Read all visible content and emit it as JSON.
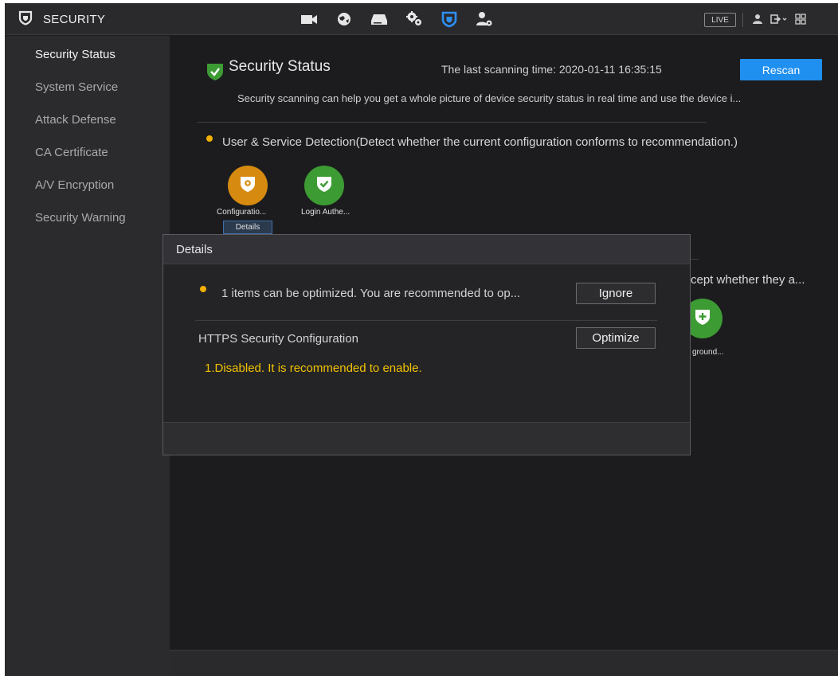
{
  "header": {
    "title": "SECURITY",
    "icons": [
      "camera-icon",
      "network-icon",
      "storage-icon",
      "system-settings-icon",
      "security-icon",
      "account-icon"
    ],
    "live_label": "LIVE",
    "right_icons": [
      "user-icon",
      "logout-icon",
      "menu-grid-icon"
    ]
  },
  "sidebar": {
    "items": [
      {
        "label": "Security Status",
        "active": true
      },
      {
        "label": "System Service",
        "active": false
      },
      {
        "label": "Attack Defense",
        "active": false
      },
      {
        "label": "CA Certificate",
        "active": false
      },
      {
        "label": "A/V Encryption",
        "active": false
      },
      {
        "label": "Security Warning",
        "active": false
      }
    ]
  },
  "main": {
    "title": "Security Status",
    "scan_time": "The last scanning time: 2020-01-11 16:35:15",
    "rescan_label": "Rescan",
    "description": "Security scanning can help you get a whole picture of device security status in real time and use the device i...",
    "user_service_section": "User & Service Detection(Detect whether the current configuration conforms to recommendation.)",
    "items": [
      {
        "label": "Configuratio...",
        "status": "warning"
      },
      {
        "label": "Login Authe...",
        "status": "ok"
      }
    ],
    "details_tab": "Details",
    "partial_section_text": "cept whether they a...",
    "partial_item_label": "ground..."
  },
  "dialog": {
    "title": "Details",
    "message": "1 items can be optimized. You are recommended to op...",
    "ignore_label": "Ignore",
    "item_name": "HTTPS Security Configuration",
    "optimize_label": "Optimize",
    "item_detail": "1.Disabled. It is recommended to enable."
  },
  "colors": {
    "accent": "#1f8ff0",
    "ok": "#3d9b34",
    "warning": "#d68a10",
    "warning_text": "#f2c200"
  }
}
